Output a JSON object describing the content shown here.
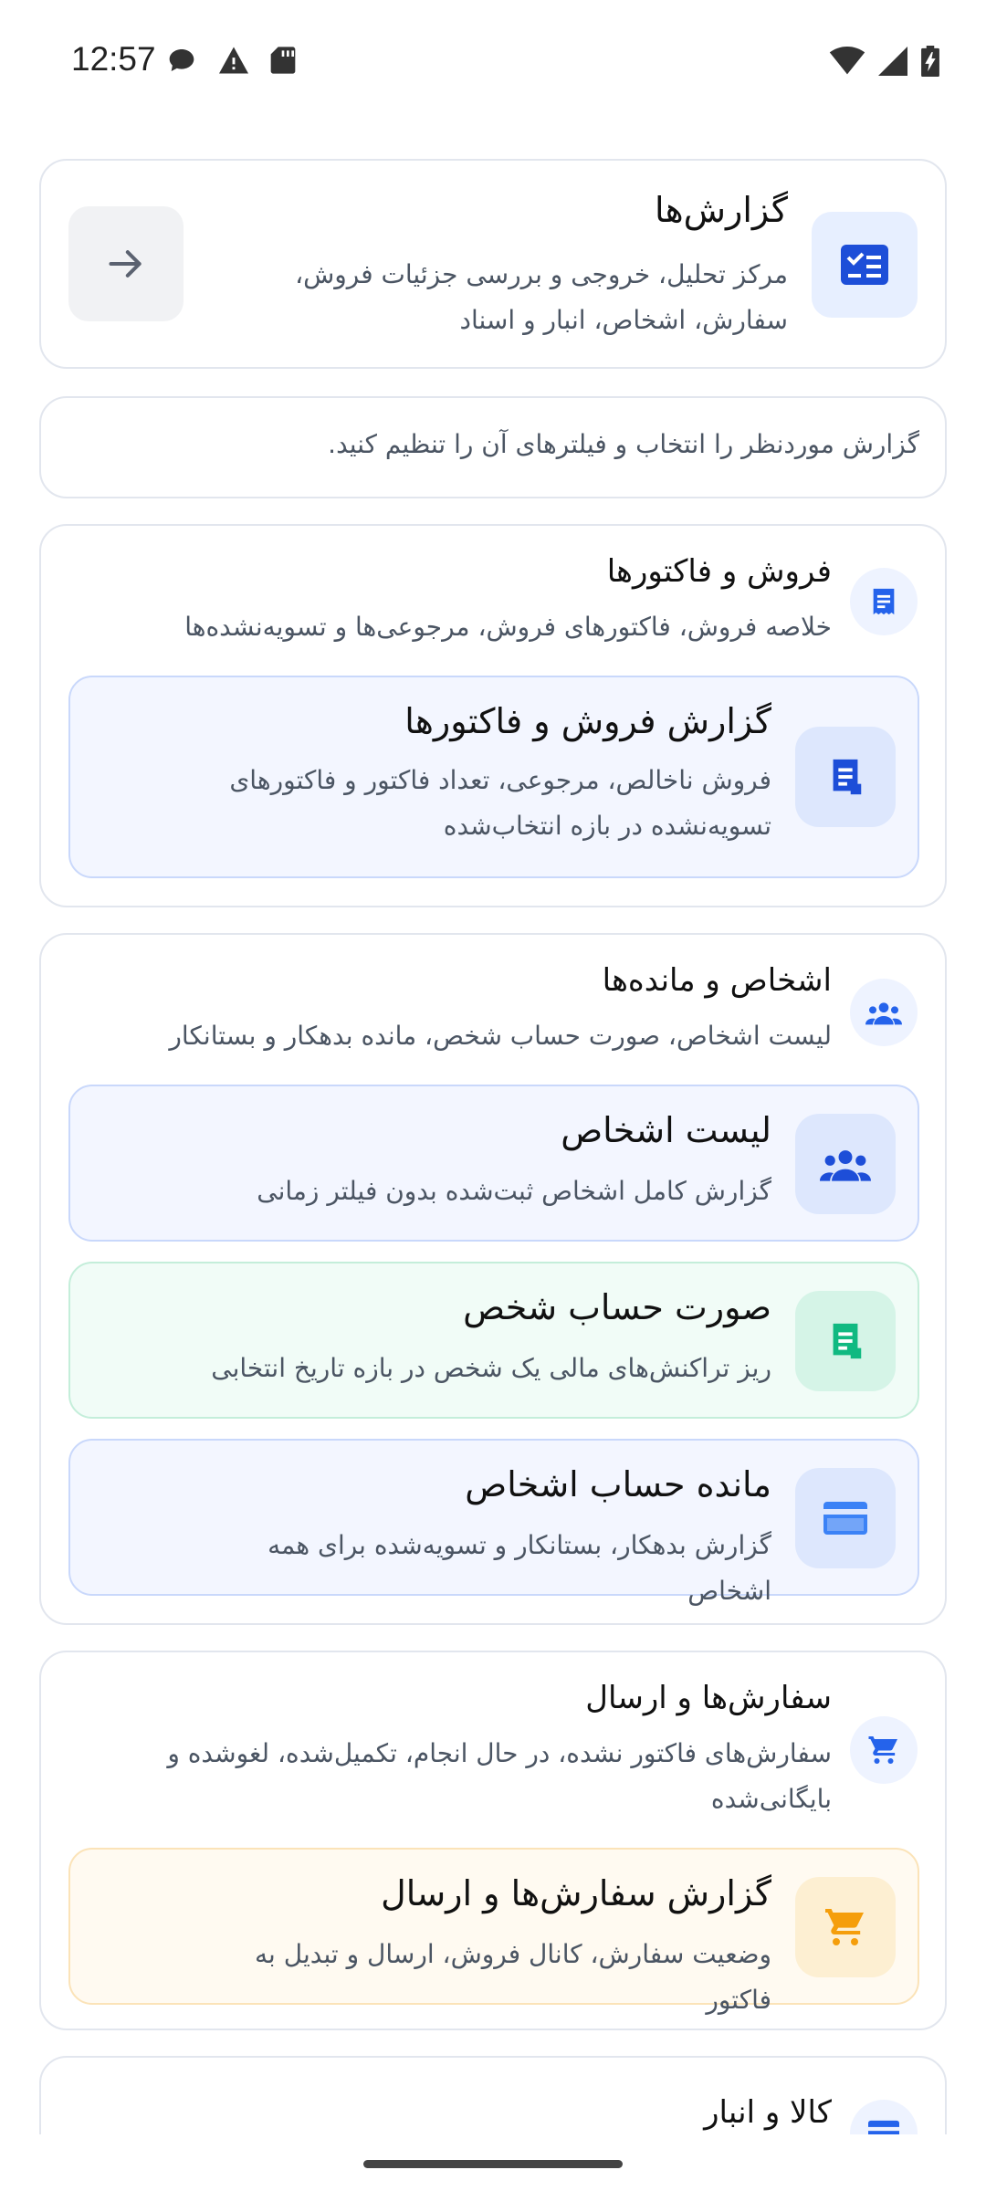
{
  "status_bar": {
    "time": "12:57",
    "icons_left": [
      "chat-bubble-icon",
      "warning-icon",
      "sd-card-icon"
    ],
    "icons_right": [
      "wifi-icon",
      "signal-icon",
      "battery-charging-icon"
    ]
  },
  "header": {
    "title": "گزارش‌ها",
    "description": "مرکز تحلیل، خروجی و بررسی جزئیات فروش، سفارش، اشخاص، انبار و اسناد",
    "icon": "checklist-icon",
    "back_icon": "arrow-right-icon"
  },
  "instruction": "گزارش موردنظر را انتخاب و فیلترهای آن را تنظیم کنید.",
  "sections": [
    {
      "title": "فروش و فاکتورها",
      "description": "خلاصه فروش، فاکتورهای فروش، مرجوعی‌ها و تسویه‌نشده‌ها",
      "icon": "receipt-icon",
      "items": [
        {
          "title": "گزارش فروش و فاکتورها",
          "description": "فروش ناخالص، مرجوعی، تعداد فاکتور و فاکتورهای تسویه‌نشده در بازه انتخاب‌شده",
          "icon": "receipt-icon",
          "color": "#2563eb"
        }
      ]
    },
    {
      "title": "اشخاص و مانده‌ها",
      "description": "لیست اشخاص، صورت حساب شخص، مانده بدهکار و بستانکار",
      "icon": "people-icon",
      "items": [
        {
          "title": "لیست اشخاص",
          "description": "گزارش کامل اشخاص ثبت‌شده بدون فیلتر زمانی",
          "icon": "people-icon",
          "color": "#2563eb"
        },
        {
          "title": "صورت حساب شخص",
          "description": "ریز تراکنش‌های مالی یک شخص در بازه تاریخ انتخابی",
          "icon": "receipt-icon",
          "color": "#10b981"
        },
        {
          "title": "مانده حساب اشخاص",
          "description": "گزارش بدهکار، بستانکار و تسویه‌شده برای همه اشخاص",
          "icon": "credit-card-icon",
          "color": "#3b82f6"
        }
      ]
    },
    {
      "title": "سفارش‌ها و ارسال",
      "description": "سفارش‌های فاکتور نشده، در حال انجام، تکمیل‌شده، لغوشده و بایگانی‌شده",
      "icon": "cart-icon",
      "items": [
        {
          "title": "گزارش سفارش‌ها و ارسال",
          "description": "وضعیت سفارش، کانال فروش، ارسال و تبدیل به فاکتور",
          "icon": "cart-icon",
          "color": "#f59e0b"
        }
      ]
    },
    {
      "title": "کالا و انبار",
      "icon": "box-icon"
    }
  ]
}
